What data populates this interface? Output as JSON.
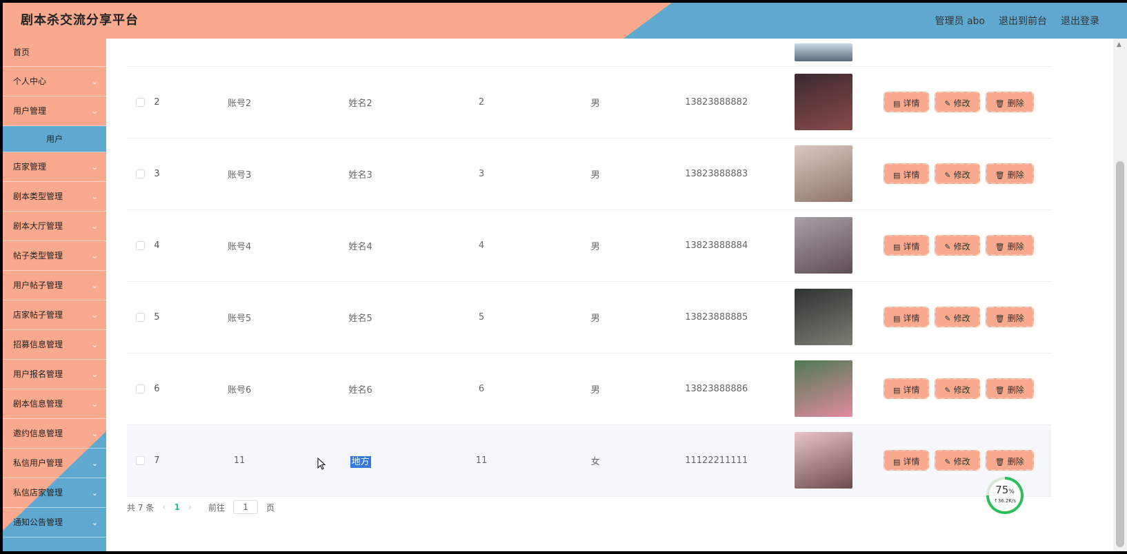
{
  "header": {
    "title": "剧本杀交流分享平台",
    "user_label": "管理员 abo",
    "back_label": "退出到前台",
    "logout_label": "退出登录"
  },
  "sidebar": {
    "items": [
      {
        "label": "首页",
        "chevron": false
      },
      {
        "label": "个人中心",
        "chevron": true
      },
      {
        "label": "用户管理",
        "chevron": true
      },
      {
        "label": "用户",
        "chevron": false,
        "sub": true
      },
      {
        "label": "店家管理",
        "chevron": true
      },
      {
        "label": "剧本类型管理",
        "chevron": true
      },
      {
        "label": "剧本大厅管理",
        "chevron": true
      },
      {
        "label": "帖子类型管理",
        "chevron": true
      },
      {
        "label": "用户帖子管理",
        "chevron": true
      },
      {
        "label": "店家帖子管理",
        "chevron": true
      },
      {
        "label": "招募信息管理",
        "chevron": true
      },
      {
        "label": "用户报名管理",
        "chevron": true
      },
      {
        "label": "剧本信息管理",
        "chevron": true
      },
      {
        "label": "邀约信息管理",
        "chevron": true
      },
      {
        "label": "私信用户管理",
        "chevron": true
      },
      {
        "label": "私信店家管理",
        "chevron": true
      },
      {
        "label": "通知公告管理",
        "chevron": true
      }
    ]
  },
  "table": {
    "rows": [
      {
        "index": "2",
        "account": "账号2",
        "name": "姓名2",
        "age": "2",
        "gender": "男",
        "phone": "13823888882",
        "avatar_colors": [
          "#3a2a2e",
          "#8a4a4c"
        ]
      },
      {
        "index": "3",
        "account": "账号3",
        "name": "姓名3",
        "age": "3",
        "gender": "男",
        "phone": "13823888883",
        "avatar_colors": [
          "#d9c8c0",
          "#8f7468"
        ]
      },
      {
        "index": "4",
        "account": "账号4",
        "name": "姓名4",
        "age": "4",
        "gender": "男",
        "phone": "13823888884",
        "avatar_colors": [
          "#a8a0a6",
          "#5e4e55"
        ]
      },
      {
        "index": "5",
        "account": "账号5",
        "name": "姓名5",
        "age": "5",
        "gender": "男",
        "phone": "13823888885",
        "avatar_colors": [
          "#2e332f",
          "#7c7e74"
        ]
      },
      {
        "index": "6",
        "account": "账号6",
        "name": "姓名6",
        "age": "6",
        "gender": "男",
        "phone": "13823888886",
        "avatar_colors": [
          "#4f7a52",
          "#e28aa0"
        ]
      },
      {
        "index": "7",
        "account": "11",
        "name": "地方",
        "age": "11",
        "gender": "女",
        "phone": "11122211111",
        "avatar_colors": [
          "#e8c4c8",
          "#6a4b4b"
        ],
        "highlight_name": true
      }
    ],
    "buttons": {
      "detail": "详情",
      "edit": "修改",
      "delete": "删除"
    }
  },
  "pagination": {
    "total": "共 7 条",
    "current_page": "1",
    "goto_label": "前往",
    "goto_value": "1",
    "page_suffix": "页"
  },
  "speed_widget": {
    "percent": "75",
    "percent_unit": "%",
    "rate": "↑36.2K/s",
    "progress": 0.75
  },
  "colors": {
    "peach": "#f9a98e",
    "blue": "#5fa9d0",
    "pager_active": "#2dbe8c"
  }
}
